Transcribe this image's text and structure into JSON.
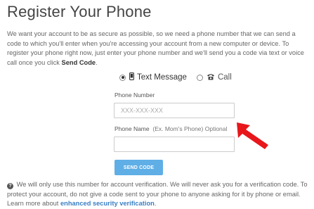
{
  "page": {
    "title": "Register Your Phone",
    "intro_text": "We want your account to be as secure as possible, so we need a phone number that we can send a code to which you'll enter when you're accessing your account from a new computer or device. To register your phone right now, just enter your phone number and we'll send you a code via text or voice call once you click ",
    "intro_bold": "Send Code",
    "intro_end": "."
  },
  "method": {
    "text_message_label": "Text Message",
    "call_label": "Call",
    "selected": "text_message"
  },
  "form": {
    "phone_number_label": "Phone Number",
    "phone_number_placeholder": "XXX-XXX-XXX",
    "phone_number_value": "",
    "phone_name_label": "Phone Name",
    "phone_name_hint": "(Ex. Mom's Phone) Optional",
    "phone_name_value": "",
    "send_button": "SEND CODE"
  },
  "footer": {
    "text": "We will only use this number for account verification. We will never ask you for a verification code. To protect your account, do not give a code sent to your phone to anyone asking for it by phone or email. Learn more about ",
    "link_text": "enhanced security verification",
    "end": "."
  },
  "colors": {
    "button": "#5faee6",
    "link": "#3a7fc4",
    "annotation_arrow": "#e8171b"
  },
  "icons": {
    "phone": "mobile-phone-icon",
    "call": "telephone-icon",
    "info": "question-circle-icon",
    "annotation": "red-arrow-icon"
  }
}
